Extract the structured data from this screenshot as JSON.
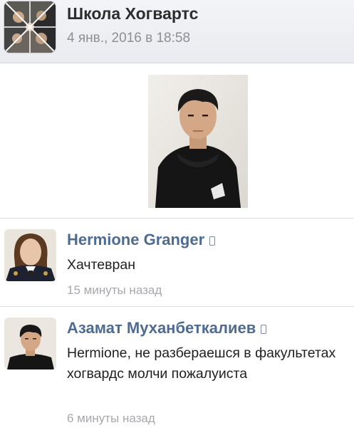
{
  "post": {
    "group_name": "Школа Хогвартс",
    "date": "4 янв., 2016 в 18:58"
  },
  "comments": [
    {
      "author": "Hermione Granger",
      "text": "Хачтевран",
      "time": "15 минуты назад"
    },
    {
      "author": "Азамат Муханбеткалиев",
      "text": "Hermione, не разбераешся в факультетах хогвардс  молчи пожалуиста",
      "time": "6 минуты назад"
    }
  ],
  "icons": {
    "mobile": "mobile-icon"
  },
  "colors": {
    "author_link": "#4d6b93",
    "timestamp": "#a7a8ad",
    "header_bg": "#eceef2"
  }
}
